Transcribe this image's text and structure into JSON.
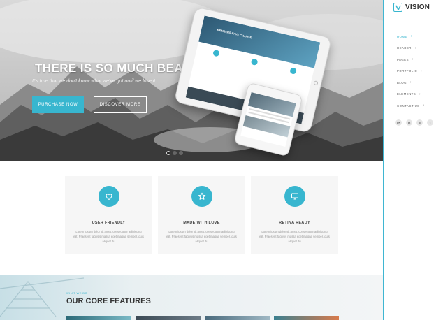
{
  "hero": {
    "title": "THERE IS SO MUCH BEAUT",
    "subtitle": "It's true that we don't know what we've got until we lose it",
    "primary_button": "PURCHASE NOW",
    "secondary_button": "DISCOVER MORE",
    "tablet_heading": "MEMBERS HAVE CHANGE",
    "slides_total": 3,
    "slide_active": 1
  },
  "features": [
    {
      "icon": "heart-icon",
      "title": "USER FRIENDLY",
      "text": "Lorem ipsum dolor sit amet, consectetur adipiscing elit. Praesent facilisis massa eget magna semper, quis aliquet du"
    },
    {
      "icon": "star-icon",
      "title": "MADE WITH LOVE",
      "text": "Lorem ipsum dolor sit amet, consectetur adipiscing elit. Praesent facilisis massa eget magna semper, quis aliquet du"
    },
    {
      "icon": "monitor-icon",
      "title": "RETINA READY",
      "text": "Lorem ipsum dolor sit amet, consectetur adipiscing elit. Praesent facilisis massa eget magna semper, quis aliquet du"
    }
  ],
  "core": {
    "eyebrow": "WHAT WE DO",
    "title": "OUR CORE FEATURES"
  },
  "sidebar": {
    "logo": "VISION",
    "nav": [
      {
        "label": "HOME",
        "active": true
      },
      {
        "label": "HEADER",
        "active": false
      },
      {
        "label": "PAGES",
        "active": false
      },
      {
        "label": "PORTFOLIO",
        "active": false
      },
      {
        "label": "BLOG",
        "active": false
      },
      {
        "label": "ELEMENTS",
        "active": false
      },
      {
        "label": "CONTACT US",
        "active": false
      }
    ],
    "social": [
      {
        "icon": "google-plus-icon",
        "glyph": "g+"
      },
      {
        "icon": "linkedin-icon",
        "glyph": "in"
      },
      {
        "icon": "pinterest-icon",
        "glyph": "p"
      },
      {
        "icon": "twitter-icon",
        "glyph": "t"
      }
    ]
  },
  "colors": {
    "accent": "#38b6cf",
    "sidebar_border": "#3fb6d2",
    "card_bg": "#f6f6f6"
  }
}
